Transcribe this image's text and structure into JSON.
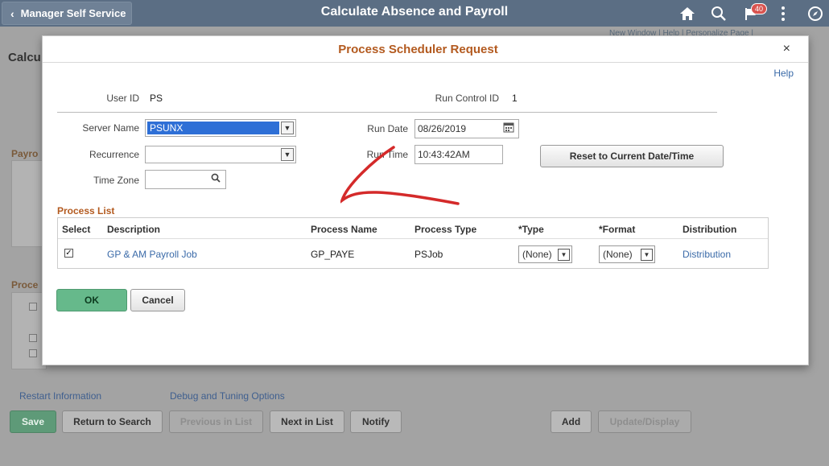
{
  "header": {
    "back_label": "Manager Self Service",
    "title": "Calculate Absence and Payroll",
    "notification_count": "40"
  },
  "background_page": {
    "title": "Calcu",
    "top_links": "New Window | Help | Personalize Page |",
    "payroll_section": "Payro",
    "process_section": "Proce",
    "restart_link": "Restart Information",
    "debug_link": "Debug and Tuning Options",
    "buttons": {
      "save": "Save",
      "return_to_search": "Return to Search",
      "previous_in_list": "Previous in List",
      "next_in_list": "Next in List",
      "notify": "Notify",
      "add": "Add",
      "update_display": "Update/Display"
    }
  },
  "modal": {
    "title": "Process Scheduler Request",
    "close": "×",
    "help": "Help",
    "user_id_label": "User ID",
    "user_id_value": "PS",
    "run_control_id_label": "Run Control ID",
    "run_control_id_value": "1",
    "server_name_label": "Server Name",
    "server_name_value": "PSUNX",
    "recurrence_label": "Recurrence",
    "recurrence_value": "",
    "time_zone_label": "Time Zone",
    "time_zone_value": "",
    "run_date_label": "Run Date",
    "run_date_value": "08/26/2019",
    "run_time_label": "Run Time",
    "run_time_value": "10:43:42AM",
    "reset_button": "Reset to Current Date/Time",
    "process_list": {
      "title": "Process List",
      "columns": [
        "Select",
        "Description",
        "Process Name",
        "Process Type",
        "*Type",
        "*Format",
        "Distribution"
      ],
      "rows": [
        {
          "selected": true,
          "description": "GP & AM Payroll Job",
          "process_name": "GP_PAYE",
          "process_type": "PSJob",
          "type": "(None)",
          "format": "(None)",
          "distribution": "Distribution"
        }
      ]
    },
    "ok_button": "OK",
    "cancel_button": "Cancel"
  },
  "colors": {
    "header_bg": "#5b6e84",
    "modal_title": "#b35a1f",
    "link": "#3a6aa8",
    "ok_button": "#66b98b",
    "highlight": "#2e6fd6",
    "annotation": "#d42a2a"
  },
  "icons": [
    "chevron-left-icon",
    "home-icon",
    "search-icon",
    "flag-icon",
    "more-vert-icon",
    "compass-icon",
    "close-icon",
    "calendar-icon",
    "magnifier-icon",
    "dropdown-arrow-icon",
    "checkbox-checked-icon"
  ]
}
